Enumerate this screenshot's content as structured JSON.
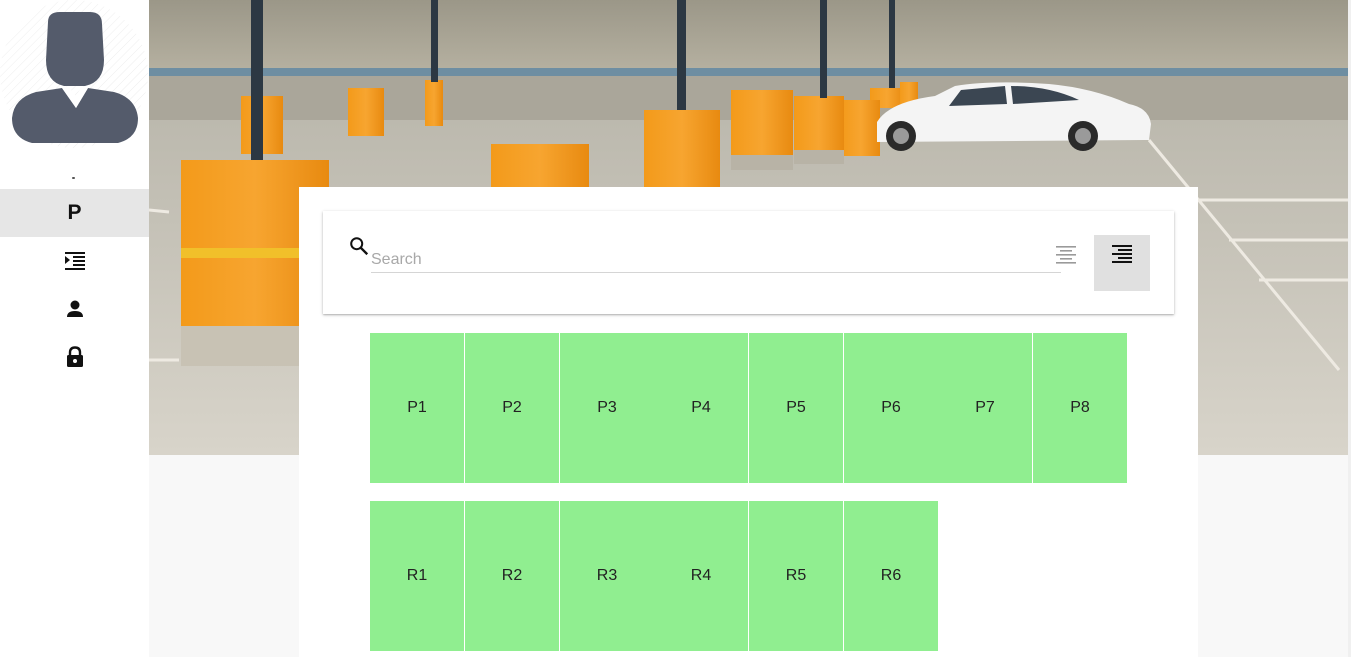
{
  "sidebar": {
    "avatar_icon": "user-silhouette",
    "items": [
      {
        "label": "P",
        "icon": "parking-p",
        "active": true
      },
      {
        "label": "",
        "icon": "format-indent-list-icon",
        "active": false
      },
      {
        "label": "",
        "icon": "person-icon",
        "active": false
      },
      {
        "label": "",
        "icon": "lock-icon",
        "active": false
      }
    ]
  },
  "hero": {
    "image": "parking-garage-photo"
  },
  "search": {
    "placeholder": "Search",
    "value": "",
    "icon": "search-icon"
  },
  "toolbar": {
    "align_center_icon": "align-center-icon",
    "align_right_icon": "align-right-icon",
    "align_right_active": true
  },
  "slots": {
    "row_p": [
      "P1",
      "P2",
      "P3",
      "P4",
      "P5",
      "P6",
      "P7",
      "P8"
    ],
    "row_r": [
      "R1",
      "R2",
      "R3",
      "R4",
      "R5",
      "R6"
    ],
    "color": "#90ee90"
  }
}
